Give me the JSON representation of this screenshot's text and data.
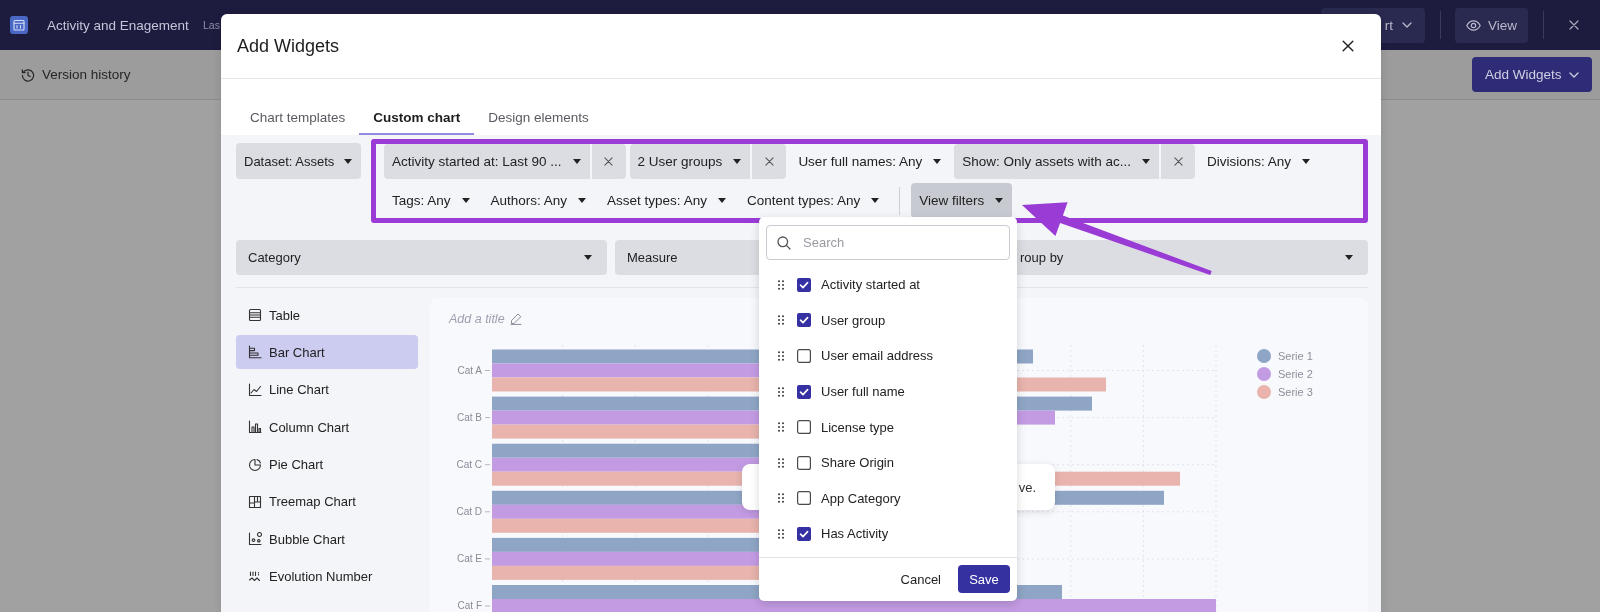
{
  "top_bar": {
    "title": "Activity and Enagement",
    "subtitle": "Las",
    "menu_button": "rt",
    "view_button": "View"
  },
  "toolbar": {
    "version_history": "Version history",
    "add_widgets": "Add Widgets"
  },
  "modal": {
    "title": "Add Widgets",
    "tabs": [
      {
        "label": "Chart templates",
        "selected": false
      },
      {
        "label": "Custom chart",
        "selected": true
      },
      {
        "label": "Design elements",
        "selected": false
      }
    ],
    "dataset": "Dataset: Assets",
    "filter_rows": [
      {
        "chips": [
          {
            "label": "Activity started at: Last 90 ...",
            "active": true
          },
          {
            "label": "2 User groups",
            "active": true
          },
          {
            "label": "User full names: Any",
            "active": false
          },
          {
            "label": "Show: Only assets with ac...",
            "active": true
          },
          {
            "label": "Divisions: Any",
            "active": false
          }
        ]
      },
      {
        "chips": [
          {
            "label": "Tags: Any",
            "active": false
          },
          {
            "label": "Authors: Any",
            "active": false
          },
          {
            "label": "Asset types: Any",
            "active": false
          },
          {
            "label": "Content types: Any",
            "active": false
          }
        ]
      }
    ],
    "view_filters": {
      "label": "View filters",
      "expanded": true
    },
    "selects": [
      {
        "label": "Category"
      },
      {
        "label": "Measure"
      },
      {
        "label": "roup by"
      }
    ],
    "chart_types": [
      {
        "label": "Table",
        "kind": "table",
        "selected": false
      },
      {
        "label": "Bar Chart",
        "kind": "bar",
        "selected": true
      },
      {
        "label": "Line Chart",
        "kind": "line",
        "selected": false
      },
      {
        "label": "Column Chart",
        "kind": "column",
        "selected": false
      },
      {
        "label": "Pie Chart",
        "kind": "pie",
        "selected": false
      },
      {
        "label": "Treemap Chart",
        "kind": "treemap",
        "selected": false
      },
      {
        "label": "Bubble Chart",
        "kind": "bubble",
        "selected": false
      },
      {
        "label": "Evolution Number",
        "kind": "evolution",
        "selected": false
      }
    ],
    "chart": {
      "title_placeholder": "Add a title",
      "categories": [
        "Cat A",
        "Cat B",
        "Cat C",
        "Cat D",
        "Cat E",
        "Cat F"
      ],
      "legend": [
        {
          "name": "Serie 1",
          "color": "#8ea5c5"
        },
        {
          "name": "Serie 2",
          "color": "#c39be3"
        },
        {
          "name": "Serie 3",
          "color": "#e8b4ad"
        }
      ]
    },
    "toast": {
      "text": "ve."
    },
    "filter_menu": {
      "search": {
        "placeholder": "Search"
      },
      "options": [
        {
          "label": "Activity started at",
          "checked": true
        },
        {
          "label": "User group",
          "checked": true
        },
        {
          "label": "User email address",
          "checked": false
        },
        {
          "label": "User full name",
          "checked": true
        },
        {
          "label": "License type",
          "checked": false
        },
        {
          "label": "Share Origin",
          "checked": false
        },
        {
          "label": "App Category",
          "checked": false
        },
        {
          "label": "Has Activity",
          "checked": true
        }
      ],
      "cancel": "Cancel",
      "save": "Save"
    }
  }
}
